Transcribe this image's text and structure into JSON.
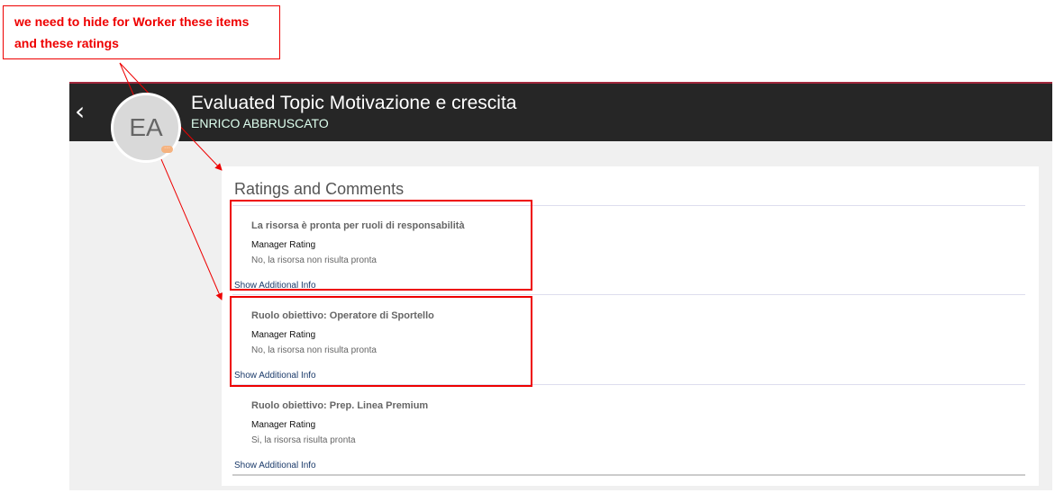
{
  "annotation": {
    "text": "we need to hide for Worker these items and these ratings",
    "color": "#ff0000"
  },
  "header": {
    "title": "Evaluated Topic Motivazione e crescita",
    "subtitle": "ENRICO ABBRUSCATO",
    "avatar_initials": "EA"
  },
  "section_title": "Ratings and Comments",
  "items": [
    {
      "title": "La risorsa è pronta per ruoli di responsabilità",
      "rating_label": "Manager Rating",
      "rating_value": "No, la risorsa non risulta pronta",
      "link": "Show Additional Info"
    },
    {
      "title": "Ruolo obiettivo: Operatore di Sportello",
      "rating_label": "Manager Rating",
      "rating_value": "No, la risorsa non risulta pronta",
      "link": "Show Additional Info"
    },
    {
      "title": "Ruolo obiettivo: Prep. Linea Premium",
      "rating_label": "Manager Rating",
      "rating_value": "Si, la risorsa risulta pronta",
      "link": "Show Additional Info"
    }
  ]
}
